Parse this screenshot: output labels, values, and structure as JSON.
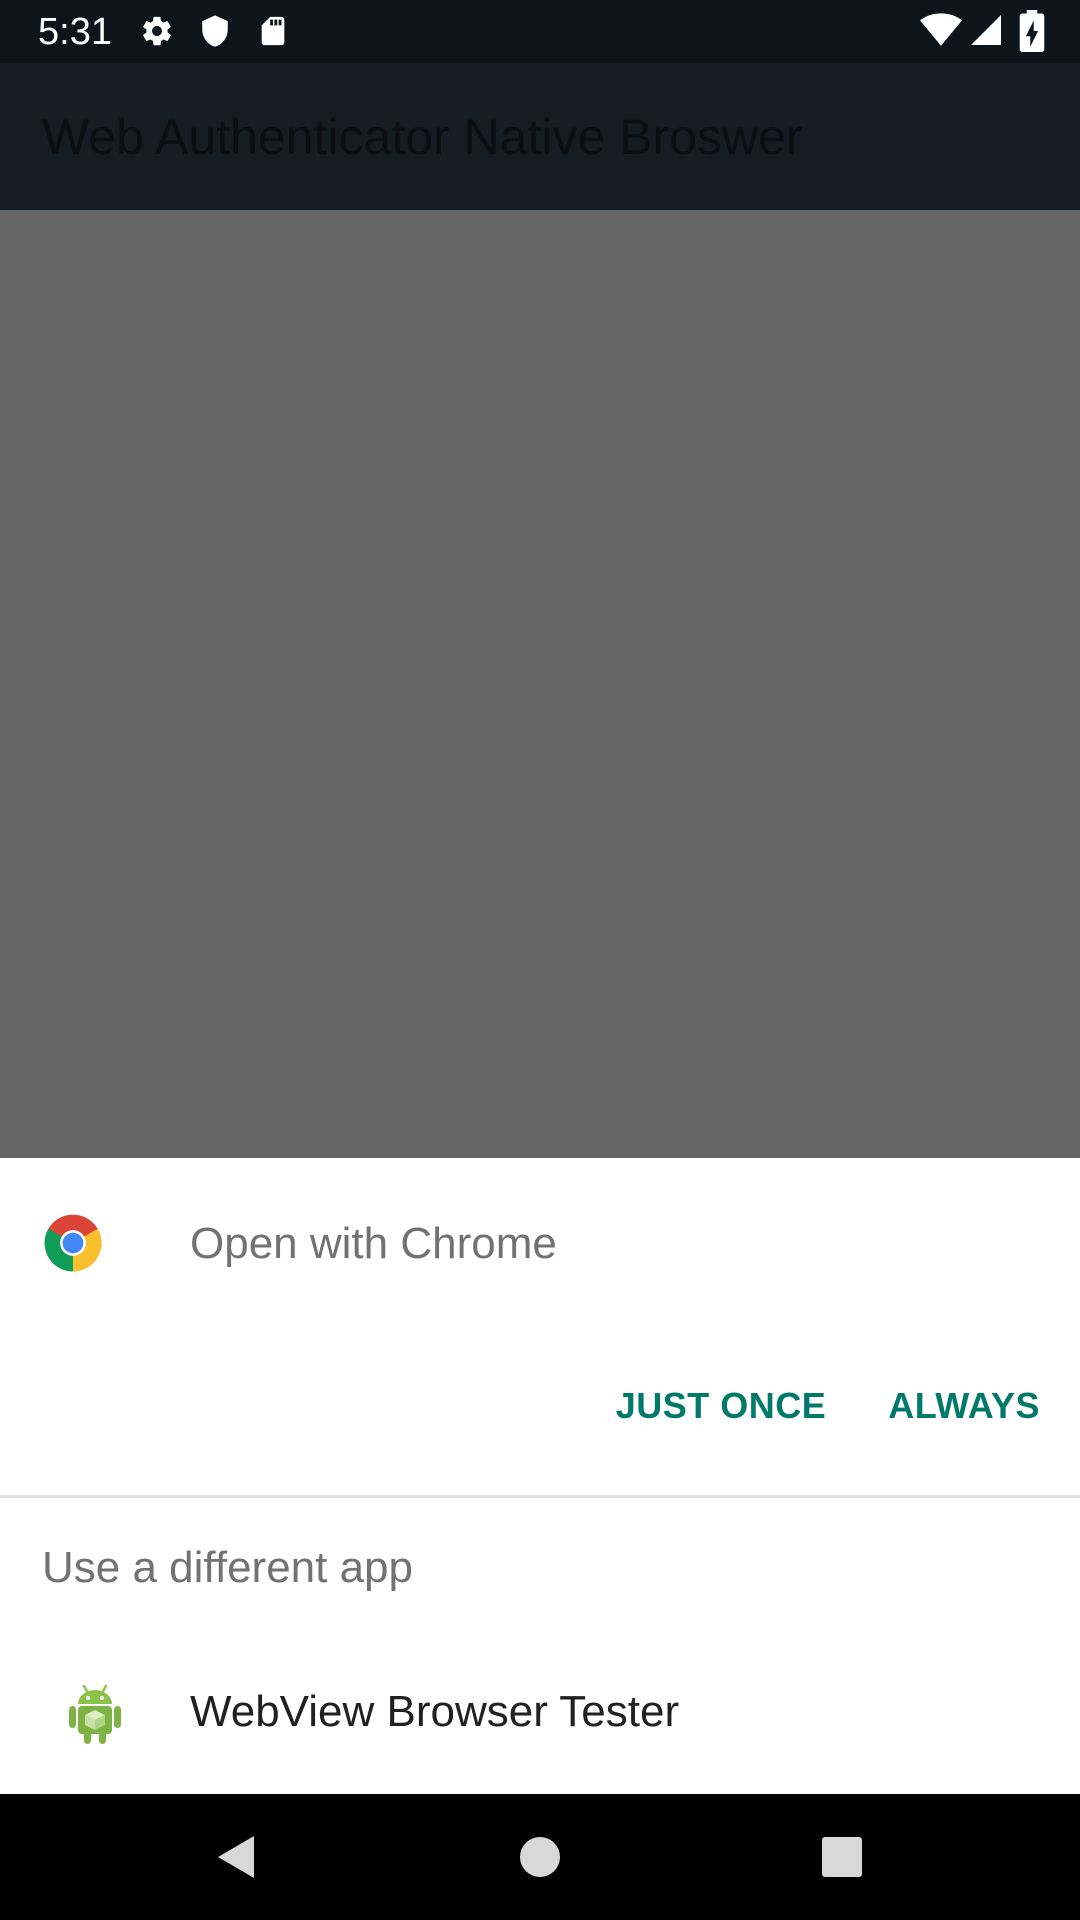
{
  "status_bar": {
    "time": "5:31",
    "icons": [
      "settings-icon",
      "shield-icon",
      "sd-card-icon",
      "wifi-icon",
      "signal-icon",
      "battery-charging-icon"
    ]
  },
  "app_bar": {
    "title": "Web Authenticator Native Broswer"
  },
  "dialog": {
    "title": "Open with Chrome",
    "title_icon": "chrome-logo-icon",
    "just_once_label": "JUST ONCE",
    "always_label": "ALWAYS",
    "subheader": "Use a different app",
    "apps": [
      {
        "label": "WebView Browser Tester",
        "icon": "android-robot-icon"
      }
    ]
  },
  "nav_bar": {
    "buttons": [
      "back-icon",
      "home-icon",
      "recents-icon"
    ]
  },
  "colors": {
    "accent": "#00796b",
    "scrim": "#666666",
    "status_bar": "#0e141a",
    "app_bar": "#161c23"
  }
}
